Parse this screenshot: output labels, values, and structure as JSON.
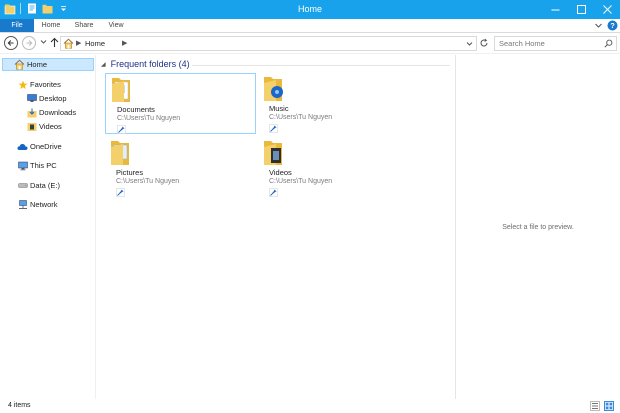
{
  "window": {
    "title": "Home"
  },
  "ribbon": {
    "tabs": [
      {
        "label": "File",
        "active": true
      },
      {
        "label": "Home"
      },
      {
        "label": "Share"
      },
      {
        "label": "View"
      }
    ]
  },
  "address": {
    "location": "Home",
    "search_placeholder": "Search Home"
  },
  "sidebar": {
    "items": [
      {
        "label": "Home",
        "icon": "home-icon",
        "selected": true
      },
      {
        "label": "Favorites",
        "icon": "star-icon"
      },
      {
        "label": "Desktop",
        "icon": "desktop-icon"
      },
      {
        "label": "Downloads",
        "icon": "downloads-icon"
      },
      {
        "label": "Videos",
        "icon": "videos-icon"
      },
      {
        "label": "OneDrive",
        "icon": "cloud-icon"
      },
      {
        "label": "This PC",
        "icon": "computer-icon"
      },
      {
        "label": "Data (E:)",
        "icon": "drive-icon"
      },
      {
        "label": "Network",
        "icon": "network-icon"
      }
    ]
  },
  "main": {
    "group_title": "Frequent folders (4)",
    "folders": [
      {
        "name": "Documents",
        "path": "C:\\Users\\Tu Nguyen",
        "icon": "documents-folder-icon",
        "selected": true
      },
      {
        "name": "Music",
        "path": "C:\\Users\\Tu Nguyen",
        "icon": "music-folder-icon"
      },
      {
        "name": "Pictures",
        "path": "C:\\Users\\Tu Nguyen",
        "icon": "pictures-folder-icon"
      },
      {
        "name": "Videos",
        "path": "C:\\Users\\Tu Nguyen",
        "icon": "videos-folder-icon"
      }
    ]
  },
  "preview": {
    "message": "Select a file to preview."
  },
  "status": {
    "item_count": "4 items"
  },
  "colors": {
    "titlebar": "#18a2ec",
    "file_tab": "#1979ca",
    "selection_bg": "#cce8ff",
    "selection_border": "#99d1ff",
    "group_header": "#1e3287",
    "folder": "#f4d06a"
  }
}
